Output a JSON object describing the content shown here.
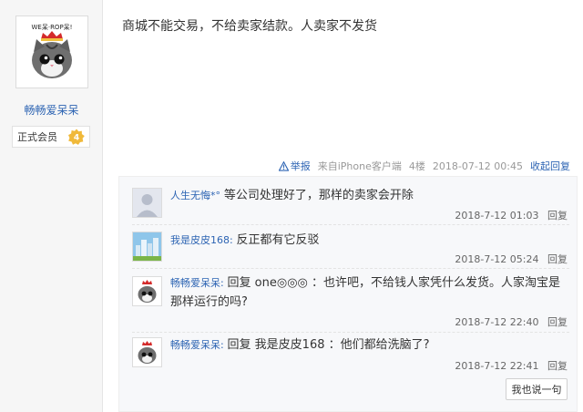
{
  "author": {
    "name": "畅畅爱呆呆",
    "role": "正式会员",
    "level": "4",
    "avatar_caption": "WE呆·ROP呆!"
  },
  "post": {
    "content": "商城不能交易，不给卖家结款。人卖家不发货",
    "tail": {
      "report": "举报",
      "source": "来自iPhone客户端",
      "floor": "4楼",
      "time": "2018-07-12 00:45",
      "collapse": "收起回复"
    }
  },
  "replies": [
    {
      "user": "人生无悔",
      "suffix": "*°",
      "content": "等公司处理好了，那样的卖家会开除",
      "time": "2018-7-12 01:03",
      "reply_btn": "回复"
    },
    {
      "user": "我是皮皮168",
      "suffix": ":",
      "content": "反正都有它反驳",
      "time": "2018-7-12 05:24",
      "reply_btn": "回复"
    },
    {
      "user": "畅畅爱呆呆",
      "suffix": ":",
      "content": "回复 one◎◎◎ ：也许吧，不给钱人家凭什么发货。人家淘宝是那样运行的吗?",
      "time": "2018-7-12 22:40",
      "reply_btn": "回复"
    },
    {
      "user": "畅畅爱呆呆",
      "suffix": ":",
      "content": "回复 我是皮皮168 ：他们都给洗脑了?",
      "time": "2018-7-12 22:41",
      "reply_btn": "回复"
    }
  ],
  "say_button": "我也说一句",
  "colors": {
    "link": "#2d64b3",
    "badge": "#f0b93a",
    "bg": "#f7f8fa"
  }
}
